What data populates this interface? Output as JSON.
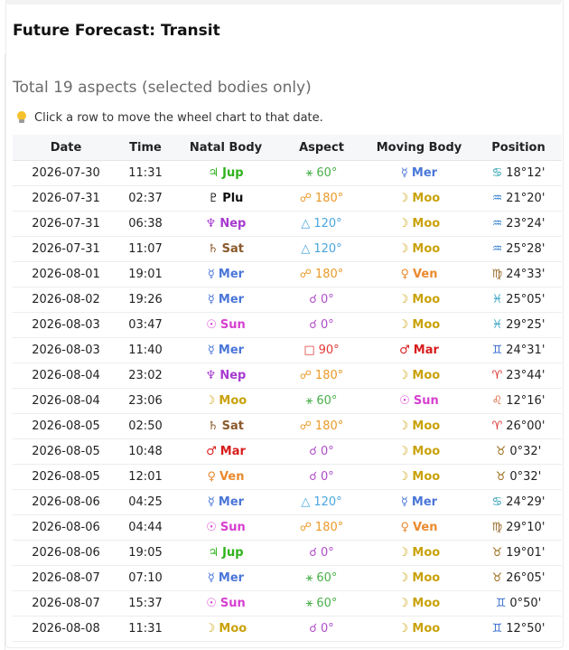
{
  "page": {
    "title": "Future Forecast: Transit",
    "summary": "Total 19 aspects (selected bodies only)",
    "hint": "Click a row to move the wheel chart to that date.",
    "hint_icon": "lightbulb-icon"
  },
  "colors": {
    "Jup": "#2fb21c",
    "Plu": "#111111",
    "Nep": "#a63ad0",
    "Sat": "#8a5a2b",
    "Mer": "#4a76d8",
    "Sun": "#d63fd0",
    "Moo": "#c9a20a",
    "Ven": "#ea8a2e",
    "Mar": "#d81c1c",
    "sextile": "#48b04a",
    "opposition": "#ea9a2a",
    "trine": "#4aa5dd",
    "conjunction": "#b04ec8",
    "square": "#e53838",
    "cancer": "#1b9bb0",
    "aquarius": "#2a7ac8",
    "virgo": "#9a6b2a",
    "pisces": "#2aa0c0",
    "gemini": "#3a6ed0",
    "aries": "#d82a2a",
    "leo": "#d8542a",
    "taurus": "#9a6b1a"
  },
  "table": {
    "headers": [
      "Date",
      "Time",
      "Natal Body",
      "Aspect",
      "Moving Body",
      "Position"
    ],
    "rows": [
      {
        "date": "2026-07-30",
        "time": "11:31",
        "natal": {
          "glyph": "♃",
          "name": "Jup",
          "color": "#2fb21c"
        },
        "aspect": {
          "glyph": "⚹",
          "text": "60°",
          "color": "#48b04a"
        },
        "moving": {
          "glyph": "☿",
          "name": "Mer",
          "color": "#4a76d8"
        },
        "position": {
          "glyph": "♋",
          "text": "18°12'",
          "color": "#1b9bb0"
        }
      },
      {
        "date": "2026-07-31",
        "time": "02:37",
        "natal": {
          "glyph": "♇",
          "name": "Plu",
          "color": "#111111"
        },
        "aspect": {
          "glyph": "☍",
          "text": "180°",
          "color": "#ea9a2a"
        },
        "moving": {
          "glyph": "☽",
          "name": "Moo",
          "color": "#c9a20a"
        },
        "position": {
          "glyph": "♒",
          "text": "21°20'",
          "color": "#2a7ac8"
        }
      },
      {
        "date": "2026-07-31",
        "time": "06:38",
        "natal": {
          "glyph": "♆",
          "name": "Nep",
          "color": "#a63ad0"
        },
        "aspect": {
          "glyph": "△",
          "text": "120°",
          "color": "#4aa5dd"
        },
        "moving": {
          "glyph": "☽",
          "name": "Moo",
          "color": "#c9a20a"
        },
        "position": {
          "glyph": "♒",
          "text": "23°24'",
          "color": "#2a7ac8"
        }
      },
      {
        "date": "2026-07-31",
        "time": "11:07",
        "natal": {
          "glyph": "♄",
          "name": "Sat",
          "color": "#8a5a2b"
        },
        "aspect": {
          "glyph": "△",
          "text": "120°",
          "color": "#4aa5dd"
        },
        "moving": {
          "glyph": "☽",
          "name": "Moo",
          "color": "#c9a20a"
        },
        "position": {
          "glyph": "♒",
          "text": "25°28'",
          "color": "#2a7ac8"
        }
      },
      {
        "date": "2026-08-01",
        "time": "19:01",
        "natal": {
          "glyph": "☿",
          "name": "Mer",
          "color": "#4a76d8"
        },
        "aspect": {
          "glyph": "☍",
          "text": "180°",
          "color": "#ea9a2a"
        },
        "moving": {
          "glyph": "♀",
          "name": "Ven",
          "color": "#ea8a2e"
        },
        "position": {
          "glyph": "♍",
          "text": "24°33'",
          "color": "#9a6b2a"
        }
      },
      {
        "date": "2026-08-02",
        "time": "19:26",
        "natal": {
          "glyph": "☿",
          "name": "Mer",
          "color": "#4a76d8"
        },
        "aspect": {
          "glyph": "☌",
          "text": "0°",
          "color": "#b04ec8"
        },
        "moving": {
          "glyph": "☽",
          "name": "Moo",
          "color": "#c9a20a"
        },
        "position": {
          "glyph": "♓",
          "text": "25°05'",
          "color": "#2aa0c0"
        }
      },
      {
        "date": "2026-08-03",
        "time": "03:47",
        "natal": {
          "glyph": "☉",
          "name": "Sun",
          "color": "#d63fd0"
        },
        "aspect": {
          "glyph": "☌",
          "text": "0°",
          "color": "#b04ec8"
        },
        "moving": {
          "glyph": "☽",
          "name": "Moo",
          "color": "#c9a20a"
        },
        "position": {
          "glyph": "♓",
          "text": "29°25'",
          "color": "#2aa0c0"
        }
      },
      {
        "date": "2026-08-03",
        "time": "11:40",
        "natal": {
          "glyph": "☿",
          "name": "Mer",
          "color": "#4a76d8"
        },
        "aspect": {
          "glyph": "□",
          "text": "90°",
          "color": "#e53838"
        },
        "moving": {
          "glyph": "♂",
          "name": "Mar",
          "color": "#d81c1c"
        },
        "position": {
          "glyph": "♊",
          "text": "24°31'",
          "color": "#3a6ed0"
        }
      },
      {
        "date": "2026-08-04",
        "time": "23:02",
        "natal": {
          "glyph": "♆",
          "name": "Nep",
          "color": "#a63ad0"
        },
        "aspect": {
          "glyph": "☍",
          "text": "180°",
          "color": "#ea9a2a"
        },
        "moving": {
          "glyph": "☽",
          "name": "Moo",
          "color": "#c9a20a"
        },
        "position": {
          "glyph": "♈",
          "text": "23°44'",
          "color": "#d82a2a"
        }
      },
      {
        "date": "2026-08-04",
        "time": "23:06",
        "natal": {
          "glyph": "☽",
          "name": "Moo",
          "color": "#c9a20a"
        },
        "aspect": {
          "glyph": "⚹",
          "text": "60°",
          "color": "#48b04a"
        },
        "moving": {
          "glyph": "☉",
          "name": "Sun",
          "color": "#d63fd0"
        },
        "position": {
          "glyph": "♌",
          "text": "12°16'",
          "color": "#d8542a"
        }
      },
      {
        "date": "2026-08-05",
        "time": "02:50",
        "natal": {
          "glyph": "♄",
          "name": "Sat",
          "color": "#8a5a2b"
        },
        "aspect": {
          "glyph": "☍",
          "text": "180°",
          "color": "#ea9a2a"
        },
        "moving": {
          "glyph": "☽",
          "name": "Moo",
          "color": "#c9a20a"
        },
        "position": {
          "glyph": "♈",
          "text": "26°00'",
          "color": "#d82a2a"
        }
      },
      {
        "date": "2026-08-05",
        "time": "10:48",
        "natal": {
          "glyph": "♂",
          "name": "Mar",
          "color": "#d81c1c"
        },
        "aspect": {
          "glyph": "☌",
          "text": "0°",
          "color": "#b04ec8"
        },
        "moving": {
          "glyph": "☽",
          "name": "Moo",
          "color": "#c9a20a"
        },
        "position": {
          "glyph": "♉",
          "text": "0°32'",
          "color": "#9a6b1a"
        }
      },
      {
        "date": "2026-08-05",
        "time": "12:01",
        "natal": {
          "glyph": "♀",
          "name": "Ven",
          "color": "#ea8a2e"
        },
        "aspect": {
          "glyph": "☌",
          "text": "0°",
          "color": "#b04ec8"
        },
        "moving": {
          "glyph": "☽",
          "name": "Moo",
          "color": "#c9a20a"
        },
        "position": {
          "glyph": "♉",
          "text": "0°32'",
          "color": "#9a6b1a"
        }
      },
      {
        "date": "2026-08-06",
        "time": "04:25",
        "natal": {
          "glyph": "☿",
          "name": "Mer",
          "color": "#4a76d8"
        },
        "aspect": {
          "glyph": "△",
          "text": "120°",
          "color": "#4aa5dd"
        },
        "moving": {
          "glyph": "☿",
          "name": "Mer",
          "color": "#4a76d8"
        },
        "position": {
          "glyph": "♋",
          "text": "24°29'",
          "color": "#1b9bb0"
        }
      },
      {
        "date": "2026-08-06",
        "time": "04:44",
        "natal": {
          "glyph": "☉",
          "name": "Sun",
          "color": "#d63fd0"
        },
        "aspect": {
          "glyph": "☍",
          "text": "180°",
          "color": "#ea9a2a"
        },
        "moving": {
          "glyph": "♀",
          "name": "Ven",
          "color": "#ea8a2e"
        },
        "position": {
          "glyph": "♍",
          "text": "29°10'",
          "color": "#9a6b2a"
        }
      },
      {
        "date": "2026-08-06",
        "time": "19:05",
        "natal": {
          "glyph": "♃",
          "name": "Jup",
          "color": "#2fb21c"
        },
        "aspect": {
          "glyph": "☌",
          "text": "0°",
          "color": "#b04ec8"
        },
        "moving": {
          "glyph": "☽",
          "name": "Moo",
          "color": "#c9a20a"
        },
        "position": {
          "glyph": "♉",
          "text": "19°01'",
          "color": "#9a6b1a"
        }
      },
      {
        "date": "2026-08-07",
        "time": "07:10",
        "natal": {
          "glyph": "☿",
          "name": "Mer",
          "color": "#4a76d8"
        },
        "aspect": {
          "glyph": "⚹",
          "text": "60°",
          "color": "#48b04a"
        },
        "moving": {
          "glyph": "☽",
          "name": "Moo",
          "color": "#c9a20a"
        },
        "position": {
          "glyph": "♉",
          "text": "26°05'",
          "color": "#9a6b1a"
        }
      },
      {
        "date": "2026-08-07",
        "time": "15:37",
        "natal": {
          "glyph": "☉",
          "name": "Sun",
          "color": "#d63fd0"
        },
        "aspect": {
          "glyph": "⚹",
          "text": "60°",
          "color": "#48b04a"
        },
        "moving": {
          "glyph": "☽",
          "name": "Moo",
          "color": "#c9a20a"
        },
        "position": {
          "glyph": "♊",
          "text": "0°50'",
          "color": "#3a6ed0"
        }
      },
      {
        "date": "2026-08-08",
        "time": "11:31",
        "natal": {
          "glyph": "☽",
          "name": "Moo",
          "color": "#c9a20a"
        },
        "aspect": {
          "glyph": "☌",
          "text": "0°",
          "color": "#b04ec8"
        },
        "moving": {
          "glyph": "☽",
          "name": "Moo",
          "color": "#c9a20a"
        },
        "position": {
          "glyph": "♊",
          "text": "12°50'",
          "color": "#3a6ed0"
        }
      }
    ]
  }
}
